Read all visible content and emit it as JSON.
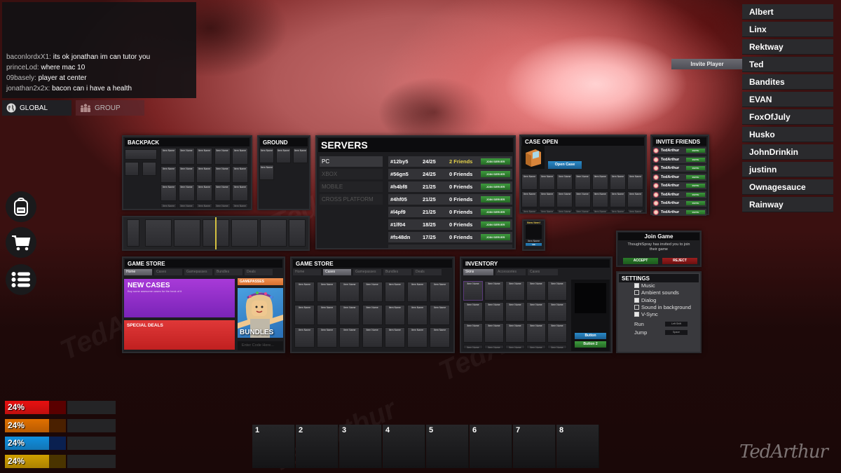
{
  "chat": {
    "messages": [
      {
        "user": "baconlordxX1:",
        "text": "its ok jonathan im can tutor you"
      },
      {
        "user": "princeLod:",
        "text": "where mac 10"
      },
      {
        "user": "09basely:",
        "text": "player at center"
      },
      {
        "user": "jonathan2x2x:",
        "text": "bacon can i have a health"
      }
    ],
    "tabs": {
      "global": "GLOBAL",
      "group": "GROUP"
    }
  },
  "players": {
    "invite_label": "Invite Player",
    "list": [
      "Albert",
      "Linx",
      "Rektway",
      "Ted",
      "Bandites",
      "EVAN",
      "FoxOfJuly",
      "Husko",
      "JohnDrinkin",
      "justinn",
      "Ownagesauce",
      "Rainway"
    ]
  },
  "side_menu": {
    "icons": [
      "backpack-icon",
      "cart-icon",
      "list-icon"
    ]
  },
  "backpack": {
    "title": "BACKPACK",
    "item_label": "Item Name",
    "hotbar_selected": 4
  },
  "ground": {
    "title": "GROUND",
    "item_label": "Item Name"
  },
  "servers": {
    "title": "SERVERS",
    "platforms": [
      {
        "label": "PC",
        "active": true
      },
      {
        "label": "XBOX",
        "active": false
      },
      {
        "label": "MOBILE",
        "active": false
      },
      {
        "label": "CROSS PLATFORM",
        "active": false
      }
    ],
    "join_label": "JOIN SERVER",
    "rows": [
      {
        "id": "#12by5",
        "players": "24/25",
        "friends": "2 Friends",
        "highlight": true
      },
      {
        "id": "#56gn5",
        "players": "24/25",
        "friends": "0 Friends",
        "highlight": false
      },
      {
        "id": "#h4bf8",
        "players": "21/25",
        "friends": "0 Friends",
        "highlight": false
      },
      {
        "id": "#4hf05",
        "players": "21/25",
        "friends": "0 Friends",
        "highlight": false
      },
      {
        "id": "#l4pf9",
        "players": "21/25",
        "friends": "0 Friends",
        "highlight": false
      },
      {
        "id": "#1lf04",
        "players": "18/25",
        "friends": "0 Friends",
        "highlight": false
      },
      {
        "id": "#fs48dn",
        "players": "17/25",
        "friends": "0 Friends",
        "highlight": false
      }
    ]
  },
  "case_open": {
    "title": "CASE OPEN",
    "button": "Open Case",
    "item_label": "Item Name"
  },
  "new_item": {
    "title": "New Item!",
    "item_label": "Item Name",
    "button": "OK"
  },
  "invite_friends": {
    "title": "INVITE FRIENDS",
    "button": "INVITE",
    "friends": [
      "TedArthur",
      "TedArthur",
      "TedArthur",
      "TedArthur",
      "TedArthur",
      "TedArthur",
      "TedArthur",
      "TedArthur"
    ]
  },
  "join_game": {
    "title": "Join Game",
    "message": "ThoughtSpray has invited you to join their game",
    "accept": "ACCEPT",
    "reject": "REJECT"
  },
  "settings": {
    "title": "SETTINGS",
    "options": [
      {
        "label": "Music",
        "checked": true
      },
      {
        "label": "Ambient sounds",
        "checked": false
      },
      {
        "label": "Dialog",
        "checked": true
      },
      {
        "label": "Sound in background",
        "checked": false
      },
      {
        "label": "V-Sync",
        "checked": true
      }
    ],
    "keybinds": [
      {
        "label": "Run",
        "key": "Left Shift"
      },
      {
        "label": "Jump",
        "key": "Space"
      }
    ]
  },
  "store_home": {
    "title": "GAME STORE",
    "tabs": [
      "Home",
      "Cases",
      "Gamepasses",
      "Bundles",
      "Deals"
    ],
    "active_tab": "Home",
    "new_cases": "NEW CASES",
    "new_cases_sub": "Buy some awesome cases for the heck of it",
    "special_deals": "SPECIAL DEALS",
    "gamepasses": "GAMEPASSES",
    "bundles": "BUNDLES",
    "code_placeholder": "Enter Code Here..."
  },
  "store_cases": {
    "title": "GAME STORE",
    "tabs": [
      "Home",
      "Cases",
      "Gamepasses",
      "Bundles",
      "Deals"
    ],
    "active_tab": "Cases",
    "item_label": "Item Name"
  },
  "inventory": {
    "title": "INVENTORY",
    "tabs": [
      "Skins",
      "Accessories",
      "Cases"
    ],
    "active_tab": "Skins",
    "item_label": "Item Name",
    "button1": "Button",
    "button2": "Button 2"
  },
  "stats": [
    {
      "name": "health",
      "value": "24%",
      "percent": 24,
      "color": "#e81010",
      "dark": "#5a0000"
    },
    {
      "name": "hunger",
      "value": "24%",
      "percent": 24,
      "color": "#e07000",
      "dark": "#4a2000"
    },
    {
      "name": "thirst",
      "value": "24%",
      "percent": 24,
      "color": "#1090e0",
      "dark": "#0a2050"
    },
    {
      "name": "stamina",
      "value": "24%",
      "percent": 24,
      "color": "#d0a000",
      "dark": "#4a3400"
    }
  ],
  "hotbar": [
    "1",
    "2",
    "3",
    "4",
    "5",
    "6",
    "7",
    "8"
  ],
  "signature": "TedArthur"
}
